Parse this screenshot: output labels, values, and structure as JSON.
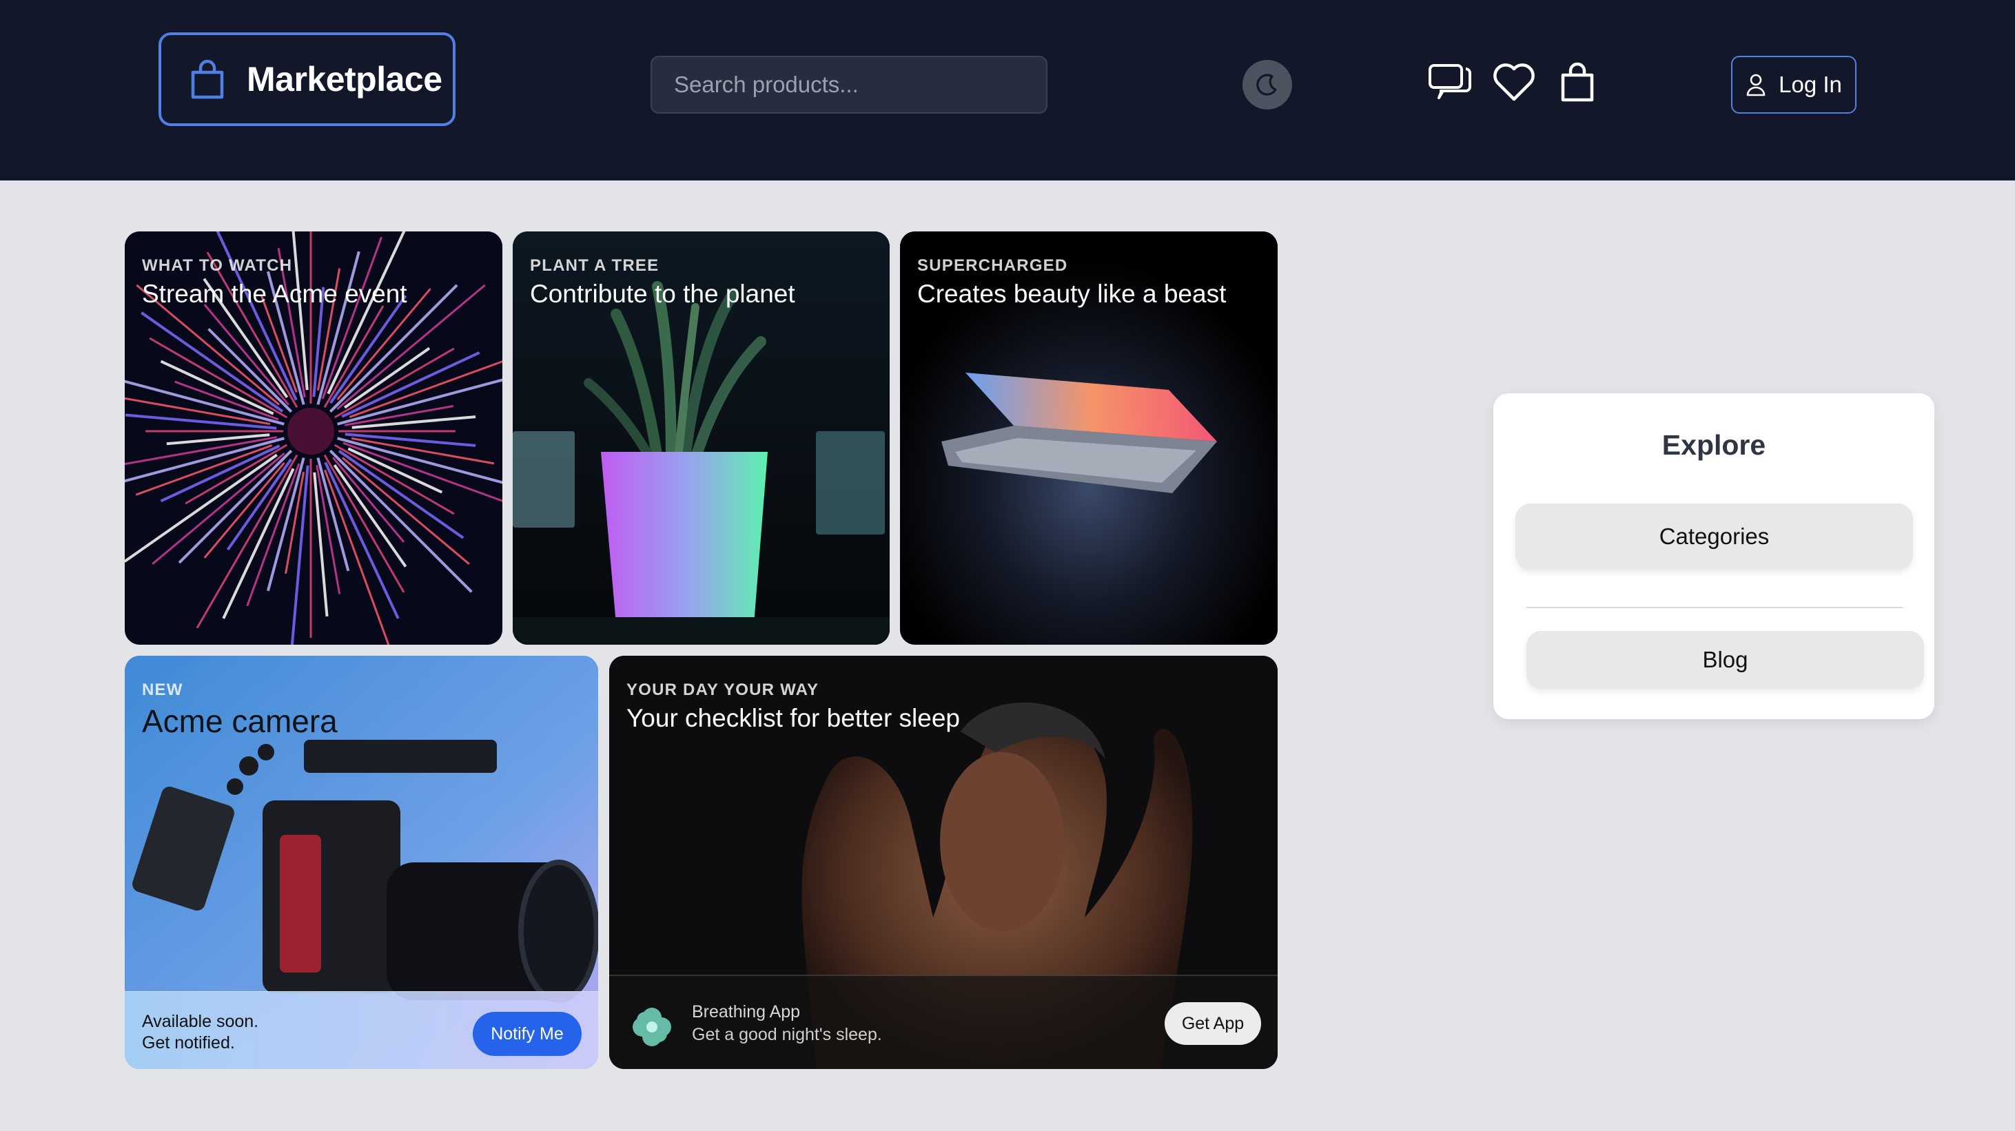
{
  "header": {
    "brand": "Marketplace",
    "search_placeholder": "Search products...",
    "login_label": "Log In",
    "icons": [
      "shopping-bag-icon",
      "moon-icon",
      "chat-icon",
      "heart-icon",
      "cart-bag-icon",
      "user-icon"
    ]
  },
  "cards": [
    {
      "eyebrow": "What to watch",
      "headline": "Stream the Acme event"
    },
    {
      "eyebrow": "Plant a tree",
      "headline": "Contribute to the planet"
    },
    {
      "eyebrow": "Supercharged",
      "headline": "Creates beauty like a beast"
    },
    {
      "eyebrow": "New",
      "headline": "Acme camera",
      "footer_line1": "Available soon.",
      "footer_line2": "Get notified.",
      "button": "Notify Me"
    },
    {
      "eyebrow": "Your day your way",
      "headline": "Your checklist for better sleep",
      "app_name": "Breathing App",
      "app_tagline": "Get a good night's sleep.",
      "button": "Get App"
    }
  ],
  "explore": {
    "title": "Explore",
    "categories_label": "Categories",
    "blog_label": "Blog"
  },
  "colors": {
    "header_bg": "#121829",
    "accent": "#4f80e6",
    "page_bg": "#e3e4e8",
    "notify_button": "#2563eb"
  }
}
